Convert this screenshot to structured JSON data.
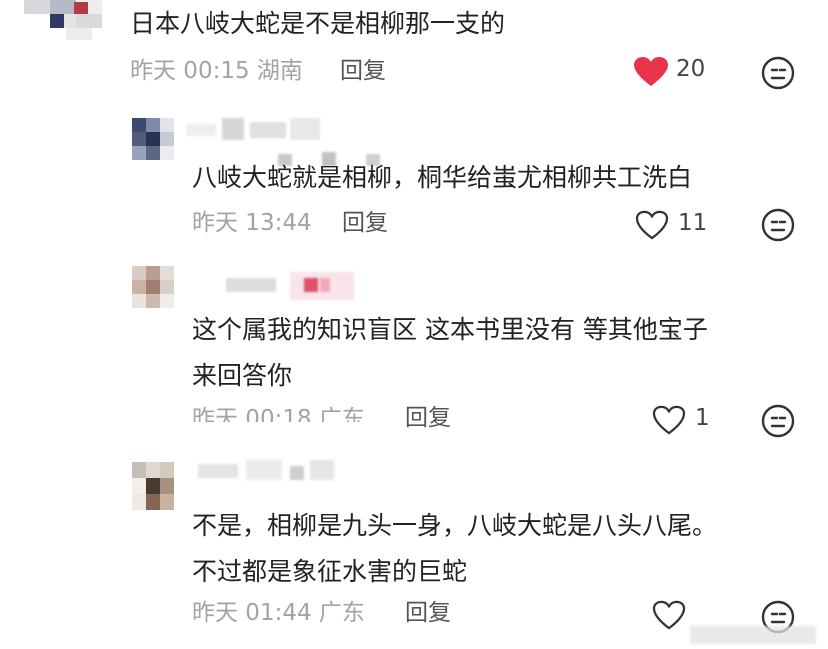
{
  "comments": [
    {
      "text": "日本八岐大蛇是不是相柳那一支的",
      "time": "昨天 00:15",
      "location": "湖南",
      "reply_label": "回复",
      "likes": "20",
      "liked": true
    },
    {
      "text": "八岐大蛇就是相柳，桐华给蚩尤相柳共工洗白",
      "time": "昨天 13:44",
      "location": "",
      "reply_label": "回复",
      "likes": "11",
      "liked": false
    },
    {
      "text_lines": [
        "这个属我的知识盲区 这本书里没有 等其他宝子",
        "来回答你"
      ],
      "time": "昨天 00:18",
      "location": "广东",
      "reply_label": "回复",
      "likes": "1",
      "liked": false
    },
    {
      "text_lines": [
        "不是，相柳是九头一身，八岐大蛇是八头八尾。",
        "不过都是象征水害的巨蛇"
      ],
      "time": "昨天 01:44",
      "location": "广东",
      "reply_label": "回复",
      "likes": "",
      "liked": false
    }
  ],
  "colors": {
    "like_active": "#e8334a",
    "meta_text": "#a3a3a3",
    "body_text": "#222222"
  },
  "icons": {
    "like": "heart-icon",
    "dislike": "unhappy-face-icon"
  }
}
